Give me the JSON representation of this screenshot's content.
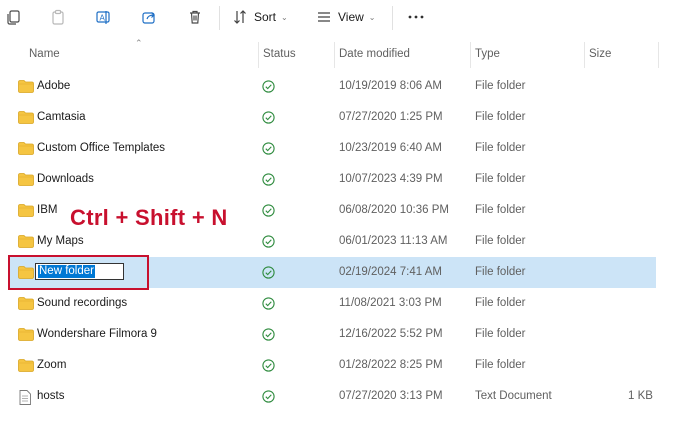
{
  "toolbar": {
    "sort_label": "Sort",
    "view_label": "View"
  },
  "columns": {
    "name": "Name",
    "status": "Status",
    "date_modified": "Date modified",
    "type": "Type",
    "size": "Size"
  },
  "files": [
    {
      "name": "Adobe",
      "date": "10/19/2019 8:06 AM",
      "type": "File folder",
      "size": "",
      "kind": "folder"
    },
    {
      "name": "Camtasia",
      "date": "07/27/2020 1:25 PM",
      "type": "File folder",
      "size": "",
      "kind": "folder"
    },
    {
      "name": "Custom Office Templates",
      "date": "10/23/2019 6:40 AM",
      "type": "File folder",
      "size": "",
      "kind": "folder"
    },
    {
      "name": "Downloads",
      "date": "10/07/2023 4:39 PM",
      "type": "File folder",
      "size": "",
      "kind": "folder"
    },
    {
      "name": "IBM",
      "date": "06/08/2020 10:36 PM",
      "type": "File folder",
      "size": "",
      "kind": "folder"
    },
    {
      "name": "My Maps",
      "date": "06/01/2023 11:13 AM",
      "type": "File folder",
      "size": "",
      "kind": "folder"
    },
    {
      "name": "New folder",
      "date": "02/19/2024 7:41 AM",
      "type": "File folder",
      "size": "",
      "kind": "folder",
      "selected": true,
      "renaming": true
    },
    {
      "name": "Sound recordings",
      "date": "11/08/2021 3:03 PM",
      "type": "File folder",
      "size": "",
      "kind": "folder"
    },
    {
      "name": "Wondershare Filmora 9",
      "date": "12/16/2022 5:52 PM",
      "type": "File folder",
      "size": "",
      "kind": "folder"
    },
    {
      "name": "Zoom",
      "date": "01/28/2022 8:25 PM",
      "type": "File folder",
      "size": "",
      "kind": "folder"
    },
    {
      "name": "hosts",
      "date": "07/27/2020 3:13 PM",
      "type": "Text Document",
      "size": "1 KB",
      "kind": "file"
    }
  ],
  "annotation": {
    "shortcut_text": "Ctrl + Shift + N",
    "color": "#c8102e"
  },
  "colors": {
    "selected_row": "#cce4f7",
    "folder": "#f5c542",
    "status_ok": "#2e8b3e",
    "rename_highlight": "#0078d4"
  }
}
